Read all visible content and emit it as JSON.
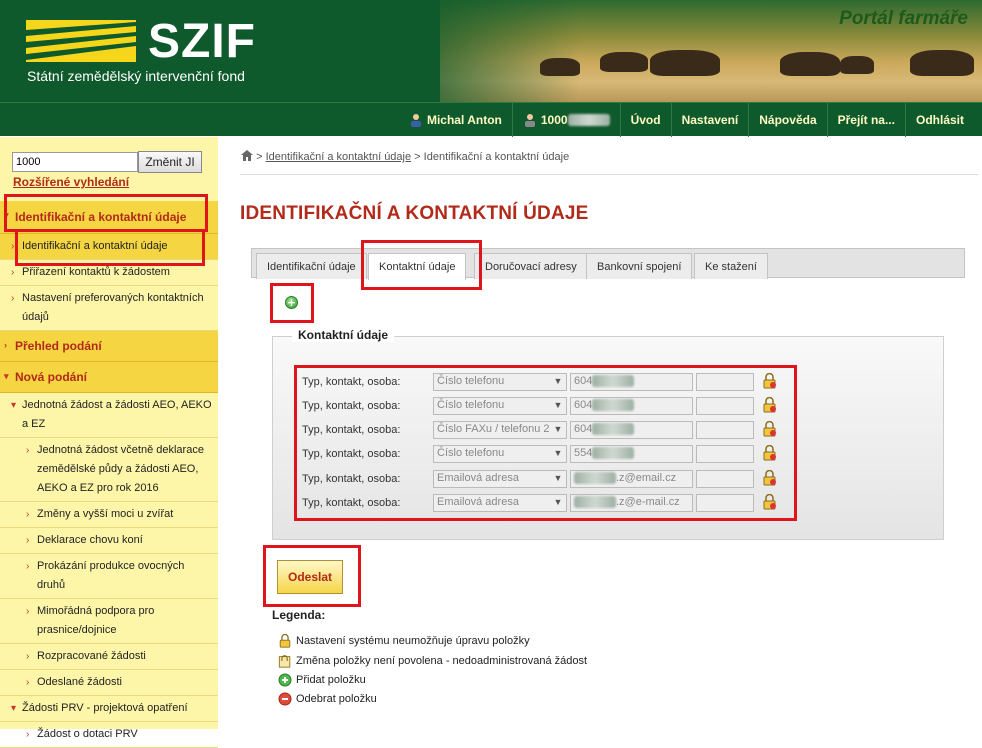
{
  "header": {
    "logo_text": "SZIF",
    "logo_subtitle": "Státní zemědělský intervenční fond",
    "portal_title": "Portál farmáře"
  },
  "nav": {
    "user_name": "Michal Anton",
    "account_prefix": "1000",
    "items": [
      "Úvod",
      "Nastavení",
      "Nápověda",
      "Přejít na...",
      "Odhlásit"
    ]
  },
  "sidebar": {
    "ji_value": "1000",
    "ji_button": "Změnit JI",
    "advanced_search": "Rozšířené vyhledání",
    "section_identification": "Identifikační a kontaktní údaje",
    "items_identification": [
      "Identifikační a kontaktní údaje",
      "Přiřazení kontaktů k žádostem",
      "Nastavení preferovaných kontaktních údajů"
    ],
    "section_overview": "Přehled podání",
    "section_new": "Nová podání",
    "item_unified": "Jednotná žádost a žádosti AEO, AEKO a EZ",
    "items_unified_sub": [
      "Jednotná žádost včetně deklarace zemědělské půdy a žádosti AEO, AEKO a EZ pro rok 2016",
      "Změny a vyšší moci u zvířat",
      "Deklarace chovu koní",
      "Prokázání produkce ovocných druhů",
      "Mimořádná podpora pro prasnice/dojnice",
      "Rozpracované žádosti",
      "Odeslané žádosti"
    ],
    "item_prv": "Žádosti PRV - projektová opatření",
    "items_prv_sub": [
      "Žádost o dotaci PRV"
    ]
  },
  "breadcrumb": {
    "link": "Identifikační a kontaktní údaje",
    "current": "Identifikační a kontaktní údaje"
  },
  "page_title": "IDENTIFIKAČNÍ A KONTAKTNÍ ÚDAJE",
  "tabs": [
    "Identifikační údaje",
    "Kontaktní údaje",
    "Doručovací adresy",
    "Bankovní spojení",
    "Ke stažení"
  ],
  "active_tab": "Kontaktní údaje",
  "contacts": {
    "legend": "Kontaktní údaje",
    "row_label": "Typ, kontakt, osoba:",
    "rows": [
      {
        "type": "Číslo telefonu",
        "value": "604"
      },
      {
        "type": "Číslo telefonu",
        "value": "604"
      },
      {
        "type": "Číslo FAXu / telefonu 2",
        "value": "604"
      },
      {
        "type": "Číslo telefonu",
        "value": "554"
      },
      {
        "type": "Emailová adresa",
        "value": ".z@email.cz"
      },
      {
        "type": "Emailová adresa",
        "value": ".z@e-mail.cz"
      }
    ]
  },
  "submit_label": "Odeslat",
  "legend": {
    "title": "Legenda:",
    "items": [
      "Nastavení systému neumožňuje úpravu položky",
      "Změna položky není povolena - nedoadministrovaná žádost",
      "Přidat položku",
      "Odebrat položku"
    ]
  },
  "colors": {
    "brand_green": "#0f5a2c",
    "sidebar_yellow": "#fdf6a8",
    "accent_red": "#b22a1a",
    "highlight_red": "#e0141b"
  }
}
